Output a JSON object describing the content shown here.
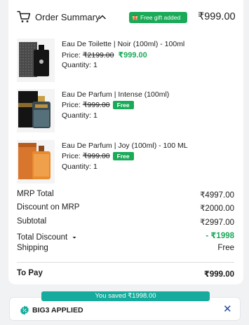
{
  "header": {
    "title": "Order Summary",
    "gift_badge": "Free gift added",
    "total": "₹999.00"
  },
  "products": [
    {
      "name": "Eau De Toilette | Noir (100ml) - 100ml",
      "price_label": "Price:",
      "mrp": "₹2199.00",
      "sale": "₹999.00",
      "free": "",
      "quantity": "Quantity: 1"
    },
    {
      "name": "Eau De Parfum | Intense (100ml)",
      "price_label": "Price:",
      "mrp": "₹999.00",
      "sale": "",
      "free": "Free",
      "quantity": "Quantity: 1"
    },
    {
      "name": "Eau De Parfum | Joy (100ml) - 100 ML",
      "price_label": "Price:",
      "mrp": "₹999.00",
      "sale": "",
      "free": "Free",
      "quantity": "Quantity: 1"
    }
  ],
  "summary": {
    "mrp_total_label": "MRP Total",
    "mrp_total": "₹4997.00",
    "discount_label": "Discount on MRP",
    "discount": "₹2000.00",
    "subtotal_label": "Subtotal",
    "subtotal": "₹2997.00",
    "total_discount_label": "Total Discount",
    "total_discount": "- ₹1998",
    "shipping_label": "Shipping",
    "shipping": "Free",
    "to_pay_label": "To Pay",
    "to_pay": "₹999.00"
  },
  "savings_banner": "You saved ₹1998.00",
  "coupon": {
    "label": "BIG3 APPLIED"
  },
  "colors": {
    "green": "#1aaa58",
    "teal": "#16ab9c",
    "close_blue": "#1f4aa8"
  }
}
